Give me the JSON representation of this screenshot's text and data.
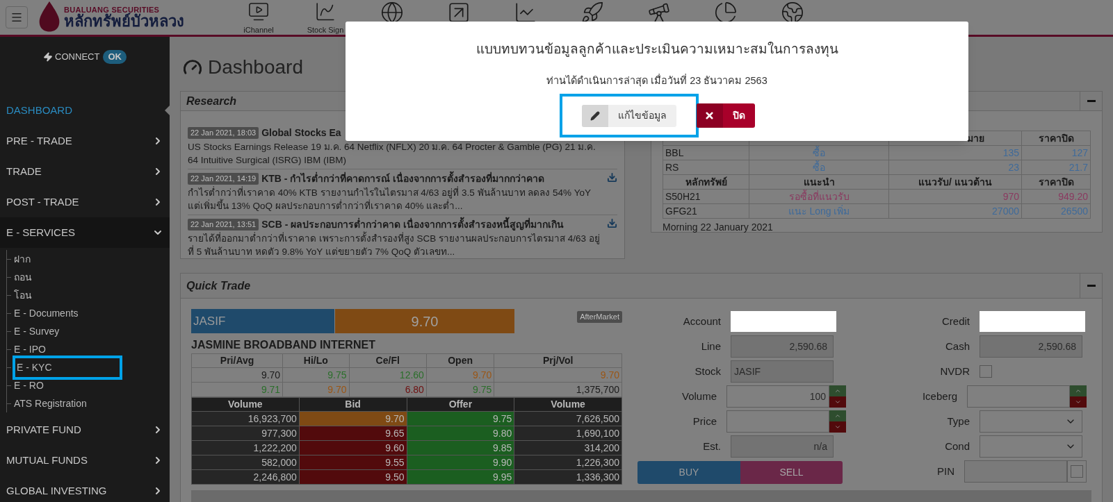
{
  "logo": {
    "line1": "BUALUANG SECURITIES",
    "line2": "หลักทรัพย์บัวหลวง"
  },
  "nav": [
    {
      "kind": "video",
      "label": "iChannel"
    },
    {
      "kind": "signal",
      "label": "Stock Sign"
    },
    {
      "kind": "ball"
    },
    {
      "kind": "arrow"
    },
    {
      "kind": "s"
    },
    {
      "kind": "rocket"
    },
    {
      "kind": "telescope"
    },
    {
      "kind": "pie"
    },
    {
      "kind": "globe"
    }
  ],
  "connect": {
    "label": "CONNECT",
    "status": "OK"
  },
  "sidebar": {
    "items": [
      {
        "kind": "link",
        "label": "DASHBOARD",
        "selected": true
      },
      {
        "kind": "group",
        "label": "PRE - TRADE",
        "selected": false,
        "expanded": false
      },
      {
        "kind": "group",
        "label": "TRADE",
        "selected": false,
        "expanded": false
      },
      {
        "kind": "group",
        "label": "POST - TRADE",
        "selected": false,
        "expanded": false
      },
      {
        "kind": "group",
        "label": "E - SERVICES",
        "selected": false,
        "expanded": true,
        "children": [
          {
            "label": "ฝาก",
            "highlighted": false
          },
          {
            "label": "ถอน",
            "highlighted": false
          },
          {
            "label": "โอน",
            "highlighted": false
          },
          {
            "label": "E - Documents",
            "highlighted": false
          },
          {
            "label": "E - Survey",
            "highlighted": false
          },
          {
            "label": "E - IPO",
            "highlighted": false
          },
          {
            "label": "E - KYC",
            "highlighted": true
          },
          {
            "label": "E - RO",
            "highlighted": false
          },
          {
            "label": "ATS Registration",
            "highlighted": false
          }
        ]
      },
      {
        "kind": "group",
        "label": "PRIVATE FUND",
        "selected": false,
        "expanded": false
      },
      {
        "kind": "group",
        "label": "MUTUAL FUNDS",
        "selected": false,
        "expanded": false
      },
      {
        "kind": "group",
        "label": "GLOBAL INVESTING",
        "selected": false,
        "expanded": false
      }
    ]
  },
  "page_title": "Dashboard",
  "research": {
    "title": "Research",
    "items": [
      {
        "date": "22 Jan 2021, 18:03",
        "title": "Global Stocks Ea",
        "body": "US Stocks Earnings Release 19 ม.ค. 64 Netflix (NFLX) 20 ม.ค. 64 Procter & Gamble (PG) 21 ม.ค. 64 Intuitive Surgical (ISRG) IBM (IBM)"
      },
      {
        "date": "22 Jan 2021, 14:19",
        "title": "KTB - กำไรต่ำกว่าที่คาดการณ์ เนื่องจากการตั้งสำรองที่มากกว่าคาด",
        "body": "กำไรต่ำกว่าที่เราคาด 40% KTB รายงานกำไรในไตรมาส 4/63 อยู่ที่ 3.5 พันล้านบาท ลดลง 54% YoY แต่เพิ่มขึ้น 13% QoQ ผลประกอบการต่ำกว่าที่เราคาด 40% และต่ำ...",
        "download": true
      },
      {
        "date": "22 Jan 2021, 13:51",
        "title": "SCB - ผลประกอบการต่ำกว่าคาด เนื่องจากการตั้งสำรองหนี้สูญที่มากเกิน",
        "body": "รายได้ที่ออกมาต่ำกว่าที่เราคาด เพราะการตั้งสำรองที่สูง SCB รายงานผลประกอบการไตรมาส 4/63 อยู่ที่ 5 พันล้านบาท หดตัว 9.8% YoY แต่ขยายตัว 7% QoQ ตัวเลขท...",
        "download": true
      }
    ]
  },
  "recommend": {
    "rows": [
      {
        "kind": "header",
        "cells": [
          null,
          null,
          "มาย",
          "ราคาปิด"
        ]
      },
      {
        "kind": "data",
        "color": "#3e6a9a",
        "cells": [
          "BBL",
          "ซื้อ",
          "135",
          "127"
        ]
      },
      {
        "kind": "data",
        "color": "#3e6a9a",
        "cells": [
          "RS",
          "ซื้อ",
          "23",
          "21.7"
        ]
      },
      {
        "kind": "header",
        "cells": [
          "หลักทรัพย์",
          "แนะนำ",
          "แนวรับ/ แนวต้าน",
          "ราคาปิด"
        ]
      },
      {
        "kind": "data",
        "color": "#8a3a60",
        "cells": [
          "S50H21",
          "รอซื้อที่แนวรับ",
          "970",
          "949.20"
        ]
      },
      {
        "kind": "data",
        "color": "#3e6a9a",
        "cells": [
          "GFG21",
          "แนะ Long เพิ่ม",
          "27000",
          "26500"
        ]
      }
    ],
    "footer": "Morning 22 January 2021"
  },
  "quick_trade": {
    "title": "Quick Trade",
    "symbol": "JASIF",
    "price": "9.70",
    "badge": "AfterMarket",
    "name": "JASMINE BROADBAND INTERNET",
    "stats": {
      "columns": [
        "Pri/Avg",
        "Hi/Lo",
        "Ce/Fl",
        "Open",
        "Prj/Vol"
      ],
      "rows": [
        [
          {
            "text": "9.70",
            "color": "#1a1a1a"
          },
          {
            "text": "9.75",
            "color": "#2a6e2a"
          },
          {
            "text": "12.60",
            "color": "#2a6e2a"
          },
          {
            "text": "9.70",
            "color": "#9a5514"
          },
          {
            "text": "9.70",
            "color": "#9a5514"
          }
        ],
        [
          {
            "text": "9.71",
            "color": "#2a6e2a"
          },
          {
            "text": "9.70",
            "color": "#9a5514"
          },
          {
            "text": "6.80",
            "color": "#6e1010"
          },
          {
            "text": "9.75",
            "color": "#2a6e2a"
          },
          {
            "text": "1,375,700",
            "color": "#1a1a1a"
          }
        ]
      ]
    },
    "depth": {
      "columns": [
        "Volume",
        "Bid",
        "Offer",
        "Volume"
      ],
      "rows": [
        {
          "bid_volume": "16,923,700",
          "bid": {
            "text": "9.70",
            "color": "#7f4a14"
          },
          "offer": {
            "text": "9.75",
            "color": "#1b5e20"
          },
          "offer_volume": "7,626,500"
        },
        {
          "bid_volume": "977,300",
          "bid": {
            "text": "9.65",
            "color": "#520a0c"
          },
          "offer": {
            "text": "9.80",
            "color": "#1b5e20"
          },
          "offer_volume": "1,690,100"
        },
        {
          "bid_volume": "1,222,200",
          "bid": {
            "text": "9.60",
            "color": "#520a0c"
          },
          "offer": {
            "text": "9.85",
            "color": "#1b5e20"
          },
          "offer_volume": "314,200"
        },
        {
          "bid_volume": "582,000",
          "bid": {
            "text": "9.55",
            "color": "#520a0c"
          },
          "offer": {
            "text": "9.90",
            "color": "#1b5e20"
          },
          "offer_volume": "1,226,300"
        },
        {
          "bid_volume": "2,246,800",
          "bid": {
            "text": "9.50",
            "color": "#520a0c"
          },
          "offer": {
            "text": "9.95",
            "color": "#1b5e20"
          },
          "offer_volume": "1,336,300"
        }
      ]
    },
    "form_left": [
      {
        "kind": "white",
        "label": "Account"
      },
      {
        "kind": "readonly",
        "label": "Line",
        "value": "2,590.68"
      },
      {
        "kind": "readonly_left",
        "label": "Stock",
        "value": "JASIF"
      },
      {
        "kind": "spin",
        "label": "Volume",
        "value": "100"
      },
      {
        "kind": "spin",
        "label": "Price"
      },
      {
        "kind": "readonly",
        "label": "Est.",
        "value": "n/a"
      }
    ],
    "form_right": [
      {
        "kind": "white",
        "label": "Credit"
      },
      {
        "kind": "readonly",
        "label": "Cash",
        "value": "2,590.68"
      },
      {
        "kind": "checkbox",
        "label": "NVDR",
        "checked": false
      },
      {
        "kind": "spin",
        "label": "Iceberg"
      },
      {
        "kind": "select",
        "label": "Type"
      },
      {
        "kind": "select",
        "label": "Cond"
      },
      {
        "kind": "pin",
        "label": "PIN",
        "checked": false
      }
    ],
    "buy": "BUY",
    "sell": "SELL"
  },
  "modal": {
    "title": "แบบทบทวนข้อมูลลูกค้าและประเมินความเหมาะสมในการลงทุน",
    "subtitle": "ท่านได้ดำเนินการล่าสุด เมื่อวันที่ 23 ธันวาคม 2563",
    "edit": {
      "label": "แก้ไขข้อมูล",
      "highlighted": true
    },
    "close": "ปิด"
  }
}
